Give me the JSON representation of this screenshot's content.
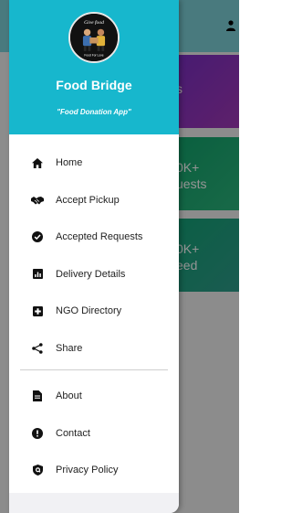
{
  "background": {
    "cards": [
      {
        "text": "s"
      },
      {
        "text": "0K+\nuests"
      },
      {
        "text": "0K+\need"
      }
    ]
  },
  "drawer": {
    "logo_text_top": "Give food",
    "logo_text_bottom": "Food For Love",
    "app_name": "Food Bridge",
    "tagline": "\"Food Donation App\"",
    "menu_primary": [
      {
        "label": "Home",
        "icon": "home-icon"
      },
      {
        "label": "Accept Pickup",
        "icon": "handshake-icon"
      },
      {
        "label": "Accepted Requests",
        "icon": "check-circle-icon"
      },
      {
        "label": "Delivery Details",
        "icon": "chart-icon"
      },
      {
        "label": "NGO Directory",
        "icon": "medical-plus-icon"
      },
      {
        "label": "Share",
        "icon": "share-icon"
      }
    ],
    "menu_secondary": [
      {
        "label": "About",
        "icon": "document-icon"
      },
      {
        "label": "Contact",
        "icon": "alert-icon"
      },
      {
        "label": "Privacy Policy",
        "icon": "shield-icon"
      }
    ]
  },
  "colors": {
    "header": "#17b7cd",
    "card_purple": "#7b2fc5",
    "card_green": "#12a56d"
  }
}
